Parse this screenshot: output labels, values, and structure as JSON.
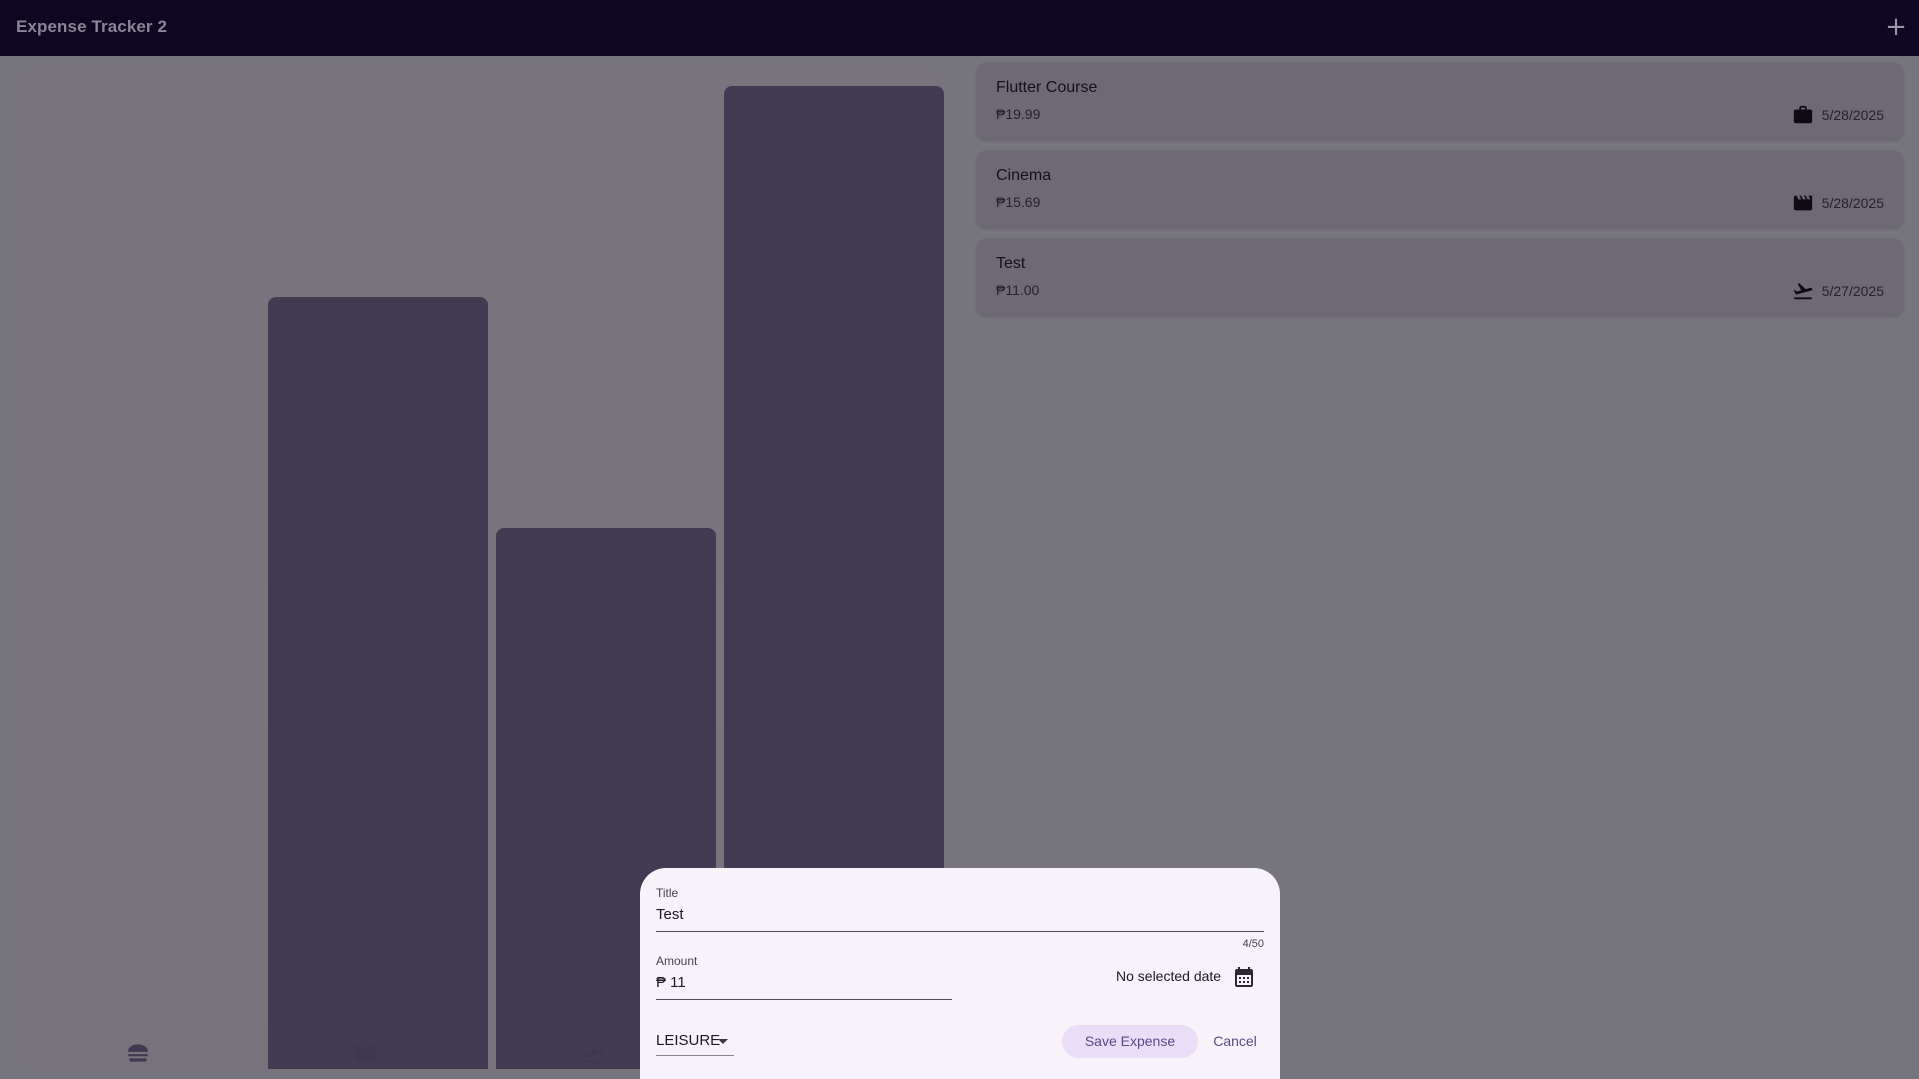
{
  "app_bar": {
    "title": "Expense Tracker 2",
    "add_icon": "plus-icon",
    "background": "#0e0622"
  },
  "chart_data": {
    "type": "bar",
    "categories": [
      "food",
      "leisure",
      "travel",
      "work"
    ],
    "category_icons": [
      "burger-icon",
      "clapperboard-icon",
      "flight-takeoff-icon",
      "briefcase-icon"
    ],
    "values": [
      0,
      15.69,
      11.0,
      19.99
    ],
    "visible_bar_count": 3,
    "bar_color": "#433b54"
  },
  "expenses": [
    {
      "title": "Flutter Course",
      "amount": "₱19.99",
      "icon": "briefcase-icon",
      "date": "5/28/2025"
    },
    {
      "title": "Cinema",
      "amount": "₱15.69",
      "icon": "clapperboard-icon",
      "date": "5/28/2025"
    },
    {
      "title": "Test",
      "amount": "₱11.00",
      "icon": "flight-takeoff-icon",
      "date": "5/27/2025"
    }
  ],
  "sheet": {
    "title_label": "Title",
    "title_value": "Test",
    "title_counter": "4/50",
    "amount_label": "Amount",
    "amount_value": "₱ 11",
    "date_text": "No selected date",
    "date_icon": "calendar-icon",
    "category_value": "LEISURE",
    "save_label": "Save Expense",
    "cancel_label": "Cancel"
  },
  "colors": {
    "accent": "#5a4a86",
    "save_button_bg": "#e9ddf8",
    "sheet_bg": "#f8f2fb"
  }
}
